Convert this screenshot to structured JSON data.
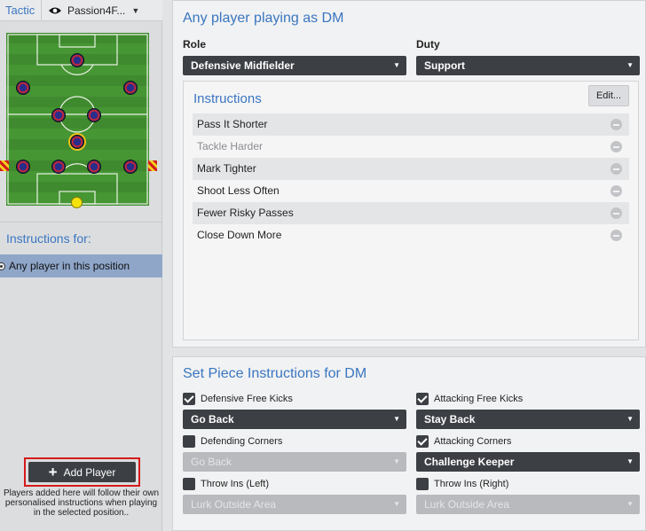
{
  "sidebar": {
    "tactic_label": "Tactic",
    "tactic_name": "Passion4F...",
    "instructions_for": "Instructions for:",
    "position_option": "Any player in this position",
    "add_player_label": "Add Player",
    "add_player_note": "Players added here will follow their own personalised instructions when playing in the selected position.."
  },
  "role_panel": {
    "title": "Any player playing as DM",
    "role_label": "Role",
    "role_value": "Defensive Midfielder",
    "duty_label": "Duty",
    "duty_value": "Support",
    "instructions_title": "Instructions",
    "edit_label": "Edit...",
    "instructions": [
      {
        "label": "Pass It Shorter",
        "muted": false
      },
      {
        "label": "Tackle Harder",
        "muted": true
      },
      {
        "label": "Mark Tighter",
        "muted": false
      },
      {
        "label": "Shoot Less Often",
        "muted": false
      },
      {
        "label": "Fewer Risky Passes",
        "muted": false
      },
      {
        "label": "Close Down More",
        "muted": false
      }
    ]
  },
  "set_piece_panel": {
    "title": "Set Piece Instructions for DM",
    "items": [
      {
        "label": "Defensive Free Kicks",
        "checked": true,
        "value": "Go Back",
        "enabled": true
      },
      {
        "label": "Attacking Free Kicks",
        "checked": true,
        "value": "Stay Back",
        "enabled": true
      },
      {
        "label": "Defending Corners",
        "checked": false,
        "value": "Go Back",
        "enabled": false
      },
      {
        "label": "Attacking Corners",
        "checked": true,
        "value": "Challenge Keeper",
        "enabled": true
      },
      {
        "label": "Throw Ins (Left)",
        "checked": false,
        "value": "Lurk Outside Area",
        "enabled": false
      },
      {
        "label": "Throw Ins (Right)",
        "checked": false,
        "value": "Lurk Outside Area",
        "enabled": false
      }
    ]
  },
  "colors": {
    "accent": "#3a76c0",
    "dropdown_bg": "#3c3f44",
    "selected_row": "#8fa6c9",
    "pitch_green": "#3f8a2e",
    "highlight_red": "#d61a1a"
  },
  "icons": {
    "visibility": "eye-icon",
    "dropdown": "caret-down-icon",
    "remove": "minus-circle-icon",
    "add": "plus-icon",
    "check": "checkmark-icon"
  }
}
